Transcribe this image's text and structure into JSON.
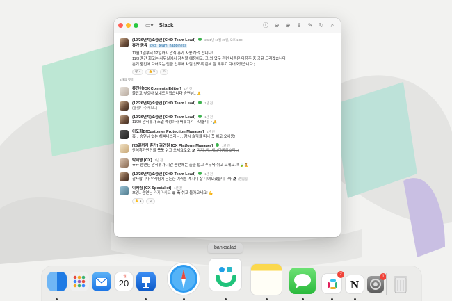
{
  "window": {
    "title": "Slack",
    "toolbar_icons": [
      "sidebar-icon",
      "info-icon",
      "zoom-out-icon",
      "zoom-in-icon",
      "share-icon",
      "markup-icon",
      "rotate-icon",
      "search-icon"
    ]
  },
  "parent_message": {
    "author": "(12/26연차)조승연 [CHD Team Lead]",
    "time": "2021년 10월 20일, 오후 1:00",
    "title": "휴가 공유",
    "mention": "@cx_team_happiness",
    "lines": [
      "11월 1일부터 12일까지 안식 휴가 사용 하려 합니다!",
      "11/3 중간 회고는 사무실에서 참석할 예정이고, 그 외 업무 관련 내용은 다음주 중 공유 드리겠습니다.",
      "분기 중간에 다녀오는 만큼 업무에 차질 없도록 준비 잘 해두고 다녀오겠습니다"
    ],
    "reactions": [
      "4",
      "5"
    ]
  },
  "thread_divider": "8개의 댓글",
  "replies": [
    {
      "author": "류진이[CX Contents Editor]",
      "time": "1년 전",
      "text": "몰랐고 싶으나 보내드리겠습니다 승연님.."
    },
    {
      "author": "(12/26연차)조승연 [CHD Team Lead]",
      "time": "1년 전",
      "text": "(몰랐다주세요..)"
    },
    {
      "author": "(12/26연차)조승연 [CHD Team Lead]",
      "time": "1년 전",
      "text": "11/20 안식휴가 소멸 예정이라 버릇치기 다녀옵니다"
    },
    {
      "author": "이도희B[Customer Protection Manager]",
      "time": "1년 전",
      "text": "흑... 승연님 없는 해삐니스라니... 잠시 슬픽을 떠나 푹 쉬고 오세용!"
    },
    {
      "author": "[26일까지 휴가] 김연원 [CX Platform Manager]",
      "time": "1년 전",
      "text": "안식휴가단만을 푹푹 쉬고 오세요오오",
      "strike": "가지..마..세..(마음의소리..)"
    },
    {
      "author": "박지영 [CX]",
      "time": "1년 전",
      "text": "ㅠㅠ 승연님 안식휴가 기간 동안에는 출출 털고 푸우욱 쉬고 오세요..!!"
    },
    {
      "author": "(12/26연차)조승연 [CHD Team Lead]",
      "time": "1년 전",
      "text": "감사합니다 우리팀에 든든한 여러분 계시니 잘 다녀오겠습니다아",
      "note": "(편집됨)"
    },
    {
      "author": "이혜림 [CX Specialist]",
      "time": "1년 전",
      "text": "흐엉.. 승연님",
      "strike": "가지마세요",
      "text_after": "푹 쉬고 돌아오세요!",
      "reactions": [
        "1"
      ]
    }
  ],
  "tooltip": "banksalad",
  "dock": {
    "calendar_month": "1월",
    "calendar_day": "20",
    "slack_badge": "2",
    "settings_badge": "1"
  }
}
